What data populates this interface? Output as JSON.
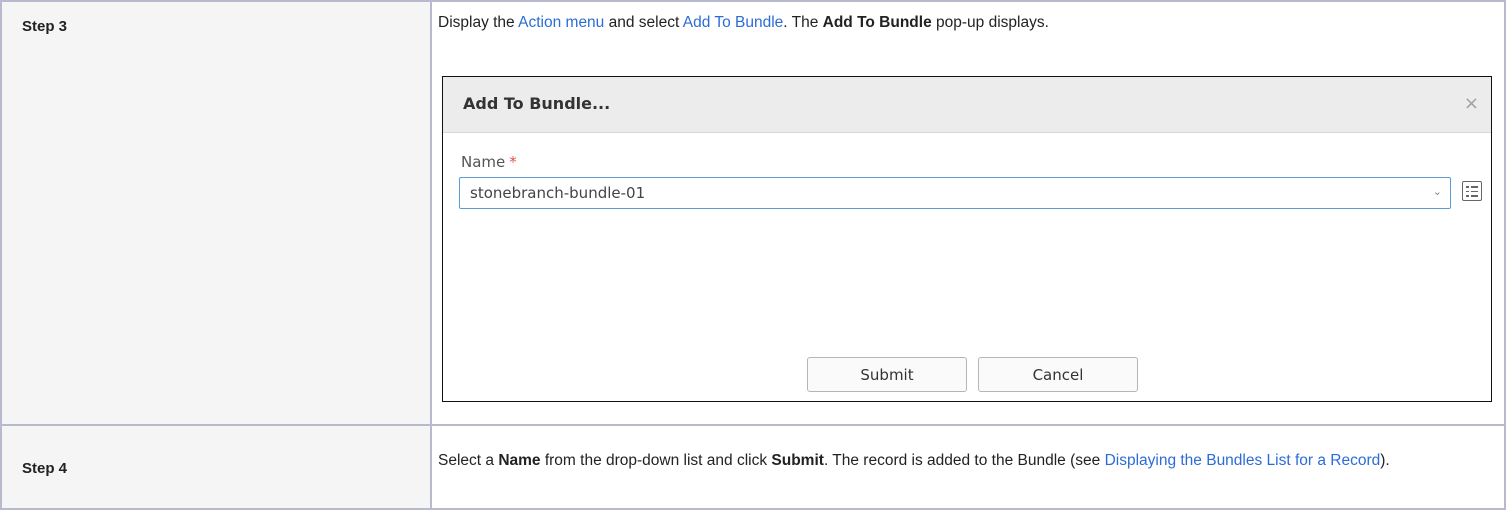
{
  "rows": [
    {
      "step": "Step 3",
      "desc": {
        "t1": "Display the ",
        "link1": "Action menu",
        "t2": " and select ",
        "link2": "Add To Bundle",
        "t3": ". The ",
        "b1": "Add To Bundle",
        "t4": " pop-up displays."
      }
    },
    {
      "step": "Step 4",
      "desc": {
        "t1": "Select a ",
        "b1": "Name",
        "t2": " from the drop-down list and click ",
        "b2": "Submit",
        "t3": ". The record is added to the Bundle (see ",
        "link1": "Displaying the Bundles List for a Record",
        "t4": ")."
      }
    }
  ],
  "dialog": {
    "title": "Add To Bundle...",
    "close_glyph": "×",
    "field_label": "Name",
    "required_mark": "*",
    "name_value": "stonebranch-bundle-01",
    "chevron_glyph": "⌄",
    "submit_label": "Submit",
    "cancel_label": "Cancel"
  },
  "colors": {
    "link": "#2c6cd6",
    "border": "#b7b9cd",
    "step_bg": "#f5f5f5"
  }
}
